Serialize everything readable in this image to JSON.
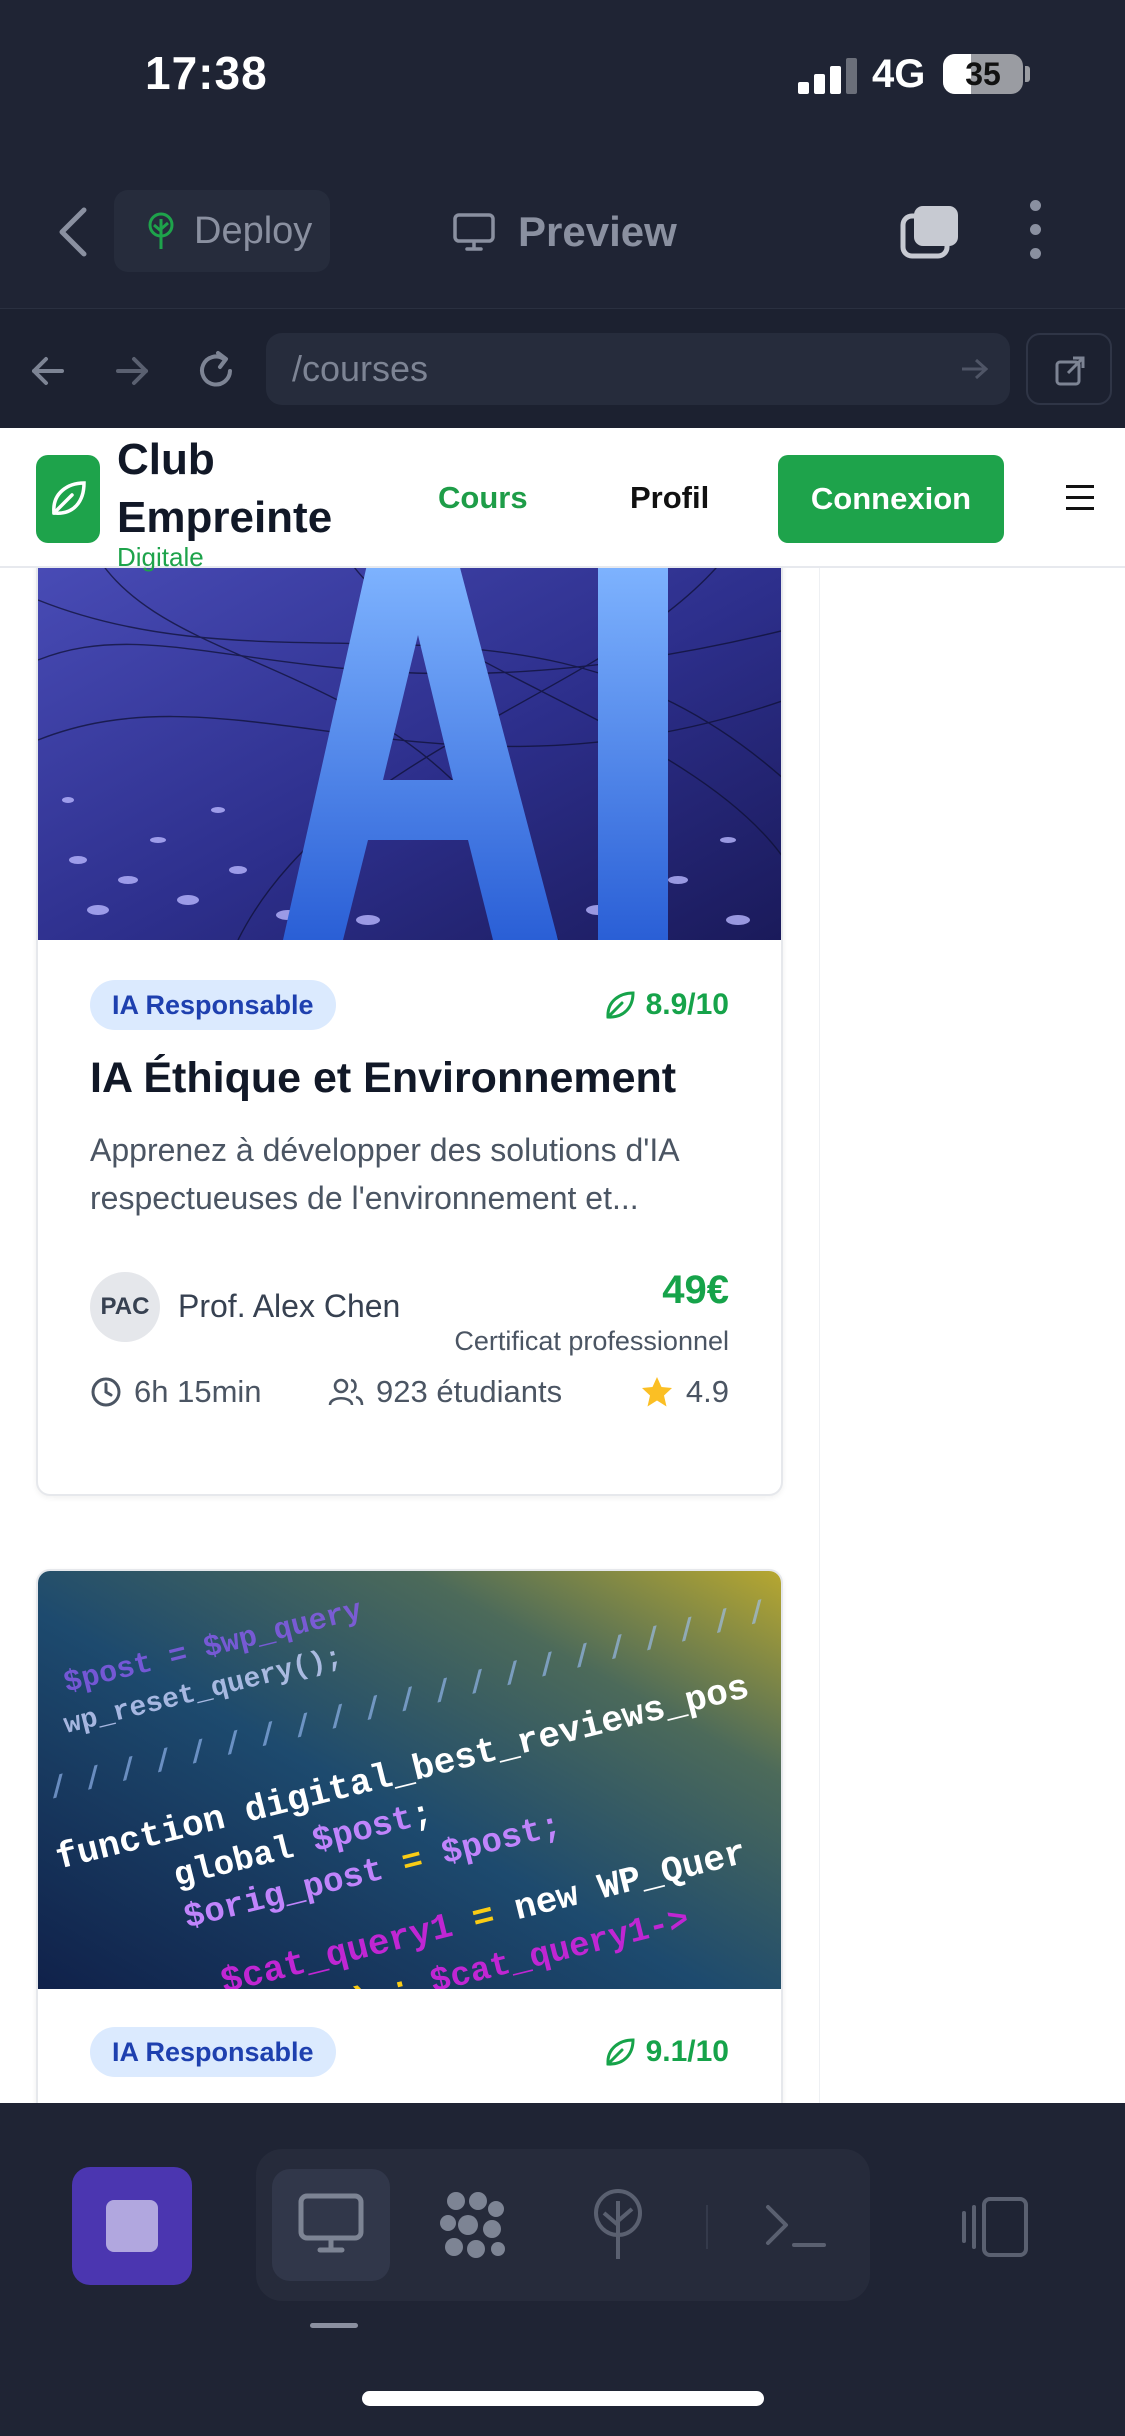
{
  "status_bar": {
    "time": "17:38",
    "network": "4G",
    "battery": "35",
    "battery_level": 0.35
  },
  "toolbar": {
    "deploy_label": "Deploy",
    "preview_label": "Preview"
  },
  "url_bar": {
    "path": "/courses"
  },
  "site": {
    "name_line1": "Club",
    "name_line2": "Empreinte",
    "name_line3": "Digitale",
    "nav": {
      "courses": "Cours",
      "profile": "Profil",
      "login": "Connexion"
    }
  },
  "courses": [
    {
      "category": "IA Responsable",
      "eco_score": "8.9/10",
      "title": "IA Éthique et Environnement",
      "description_line1": "Apprenez à développer des solutions d'IA",
      "description_line2": "respectueuses de l'environnement et...",
      "instructor_initials": "PAC",
      "instructor": "Prof. Alex Chen",
      "price": "49€",
      "certificate": "Certificat professionnel",
      "duration": "6h 15min",
      "students": "923 étudiants",
      "rating": "4.9",
      "image_text": "AI"
    },
    {
      "category": "IA Responsable",
      "eco_score": "9.1/10"
    }
  ],
  "colors": {
    "brand_green": "#1ea34b",
    "badge_bg": "#dbeafe",
    "badge_text": "#1e40af",
    "accent_purple": "#4b36b0"
  }
}
